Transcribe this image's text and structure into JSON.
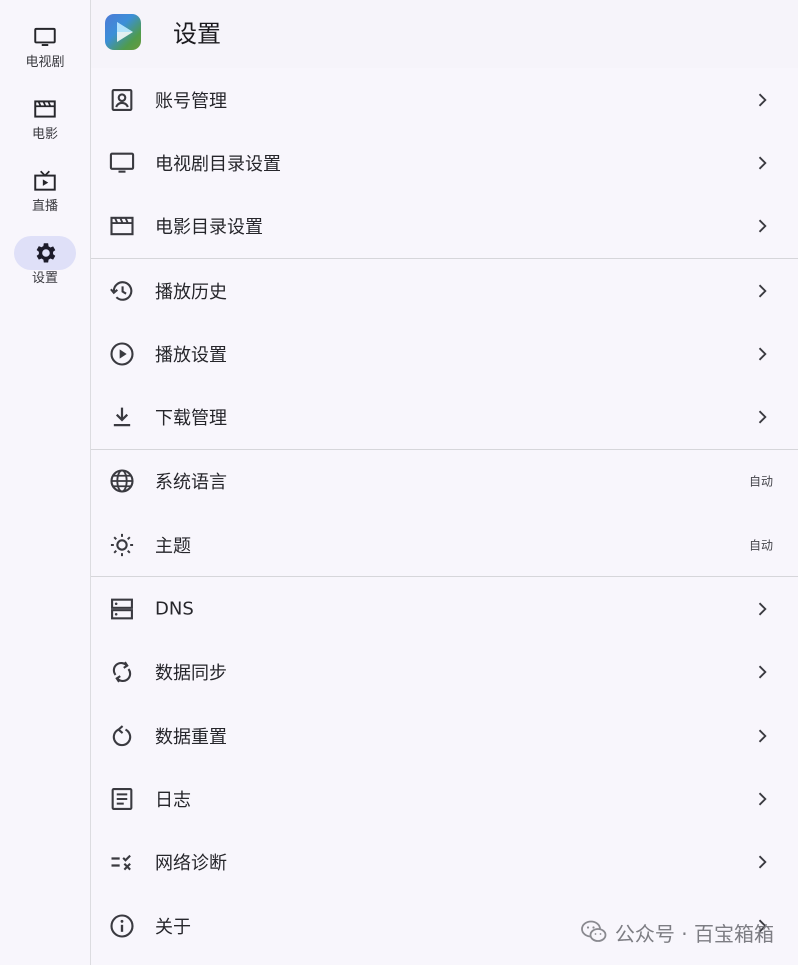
{
  "nav": {
    "items": [
      {
        "label": "电视剧",
        "icon": "tv-icon",
        "active": false
      },
      {
        "label": "电影",
        "icon": "movie-icon",
        "active": false
      },
      {
        "label": "直播",
        "icon": "live-tv-icon",
        "active": false
      },
      {
        "label": "设置",
        "icon": "gear-icon",
        "active": true
      }
    ]
  },
  "header": {
    "title": "设置",
    "logo": "app-logo-play-icon"
  },
  "settings": {
    "groups": [
      [
        {
          "label": "账号管理",
          "icon": "account-box-icon",
          "trailing": "chevron"
        },
        {
          "label": "电视剧目录设置",
          "icon": "tv-icon",
          "trailing": "chevron"
        },
        {
          "label": "电影目录设置",
          "icon": "movie-icon",
          "trailing": "chevron"
        }
      ],
      [
        {
          "label": "播放历史",
          "icon": "history-icon",
          "trailing": "chevron"
        },
        {
          "label": "播放设置",
          "icon": "play-circle-icon",
          "trailing": "chevron"
        },
        {
          "label": "下载管理",
          "icon": "download-icon",
          "trailing": "chevron"
        }
      ],
      [
        {
          "label": "系统语言",
          "icon": "globe-icon",
          "trailing": "value",
          "value": "自动"
        },
        {
          "label": "主题",
          "icon": "brightness-icon",
          "trailing": "value",
          "value": "自动"
        }
      ],
      [
        {
          "label": "DNS",
          "icon": "dns-server-icon",
          "trailing": "chevron"
        },
        {
          "label": "数据同步",
          "icon": "sync-icon",
          "trailing": "chevron"
        },
        {
          "label": "数据重置",
          "icon": "reset-icon",
          "trailing": "chevron"
        },
        {
          "label": "日志",
          "icon": "article-icon",
          "trailing": "chevron"
        },
        {
          "label": "网络诊断",
          "icon": "checklist-icon",
          "trailing": "chevron"
        },
        {
          "label": "关于",
          "icon": "info-icon",
          "trailing": "chevron"
        }
      ]
    ]
  },
  "watermark": {
    "text": "公众号 · 百宝箱箱",
    "icon": "wechat-icon"
  },
  "colors": {
    "background": "#f8f6fc",
    "active_indicator": "#dfe0f8",
    "divider": "#d6d6da",
    "icon": "#3a3a40"
  }
}
